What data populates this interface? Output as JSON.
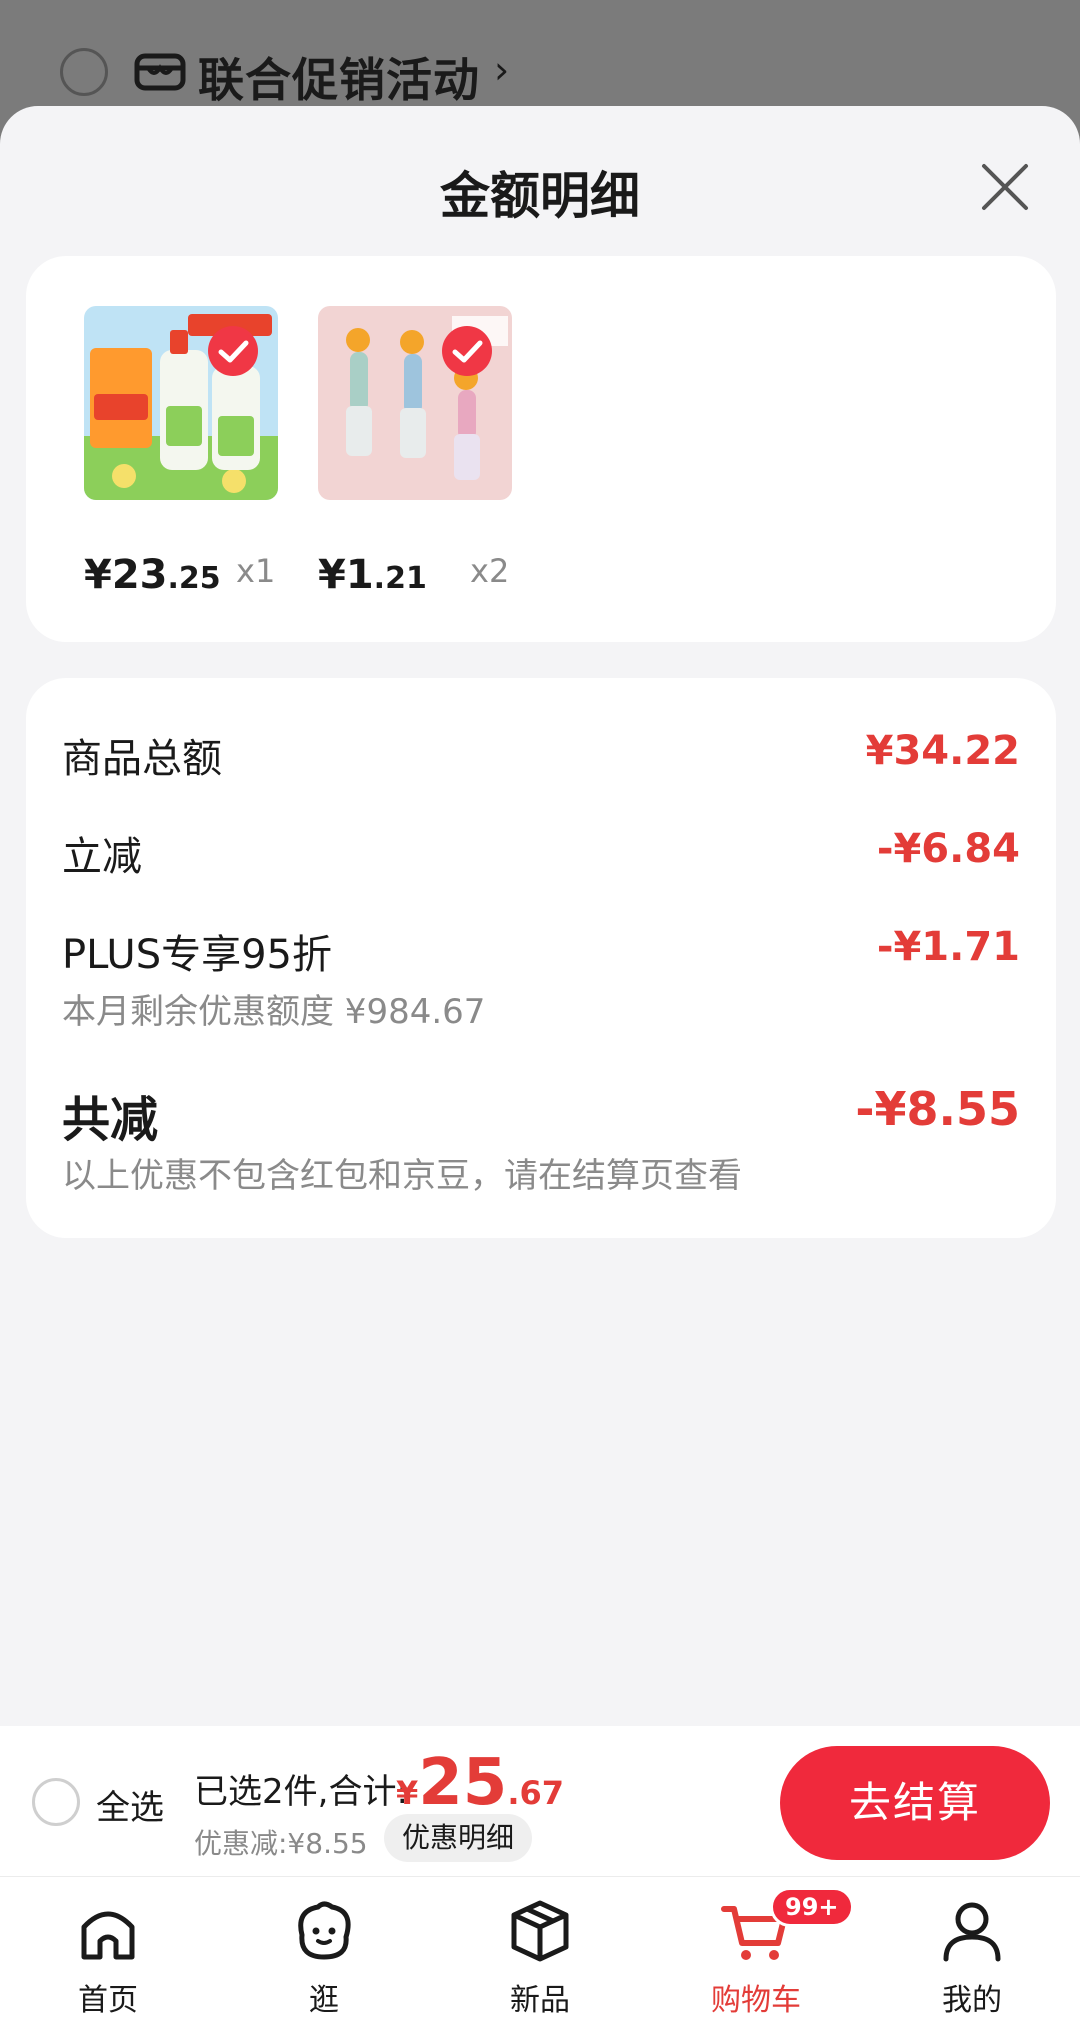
{
  "background": {
    "title": "联合促销活动",
    "chevron": "›"
  },
  "modal": {
    "title": "金额明细"
  },
  "products": [
    {
      "price_int": "¥23",
      "price_dec": ".25",
      "qty": "x1",
      "selected": true
    },
    {
      "price_int": "¥1",
      "price_dec": ".21",
      "qty": "x2",
      "selected": true
    }
  ],
  "breakdown": {
    "subtotal_label": "商品总额",
    "subtotal_value": "¥34.22",
    "instant_label": "立减",
    "instant_value": "-¥6.84",
    "plus_label": "PLUS专享95折",
    "plus_value": "-¥1.71",
    "plus_sub": "本月剩余优惠额度 ¥984.67",
    "total_label": "共减",
    "total_value": "-¥8.55",
    "total_sub": "以上优惠不包含红包和京豆，请在结算页查看"
  },
  "checkout": {
    "select_all": "全选",
    "summary": "已选2件,合计:",
    "total_yen": "¥",
    "total_int": "25",
    "total_dec": ".67",
    "discount": "优惠减:¥8.55",
    "detail_button": "优惠明细",
    "checkout_button": "去结算"
  },
  "tabs": [
    {
      "label": "首页",
      "icon": "home-icon"
    },
    {
      "label": "逛",
      "icon": "browse-icon"
    },
    {
      "label": "新品",
      "icon": "box-icon"
    },
    {
      "label": "购物车",
      "icon": "cart-icon",
      "active": true
    },
    {
      "label": "我的",
      "icon": "user-icon"
    }
  ],
  "cart_badge": "99+",
  "colors": {
    "accent": "#e33c38",
    "button": "#f0293c",
    "muted": "#8a8a8a"
  }
}
